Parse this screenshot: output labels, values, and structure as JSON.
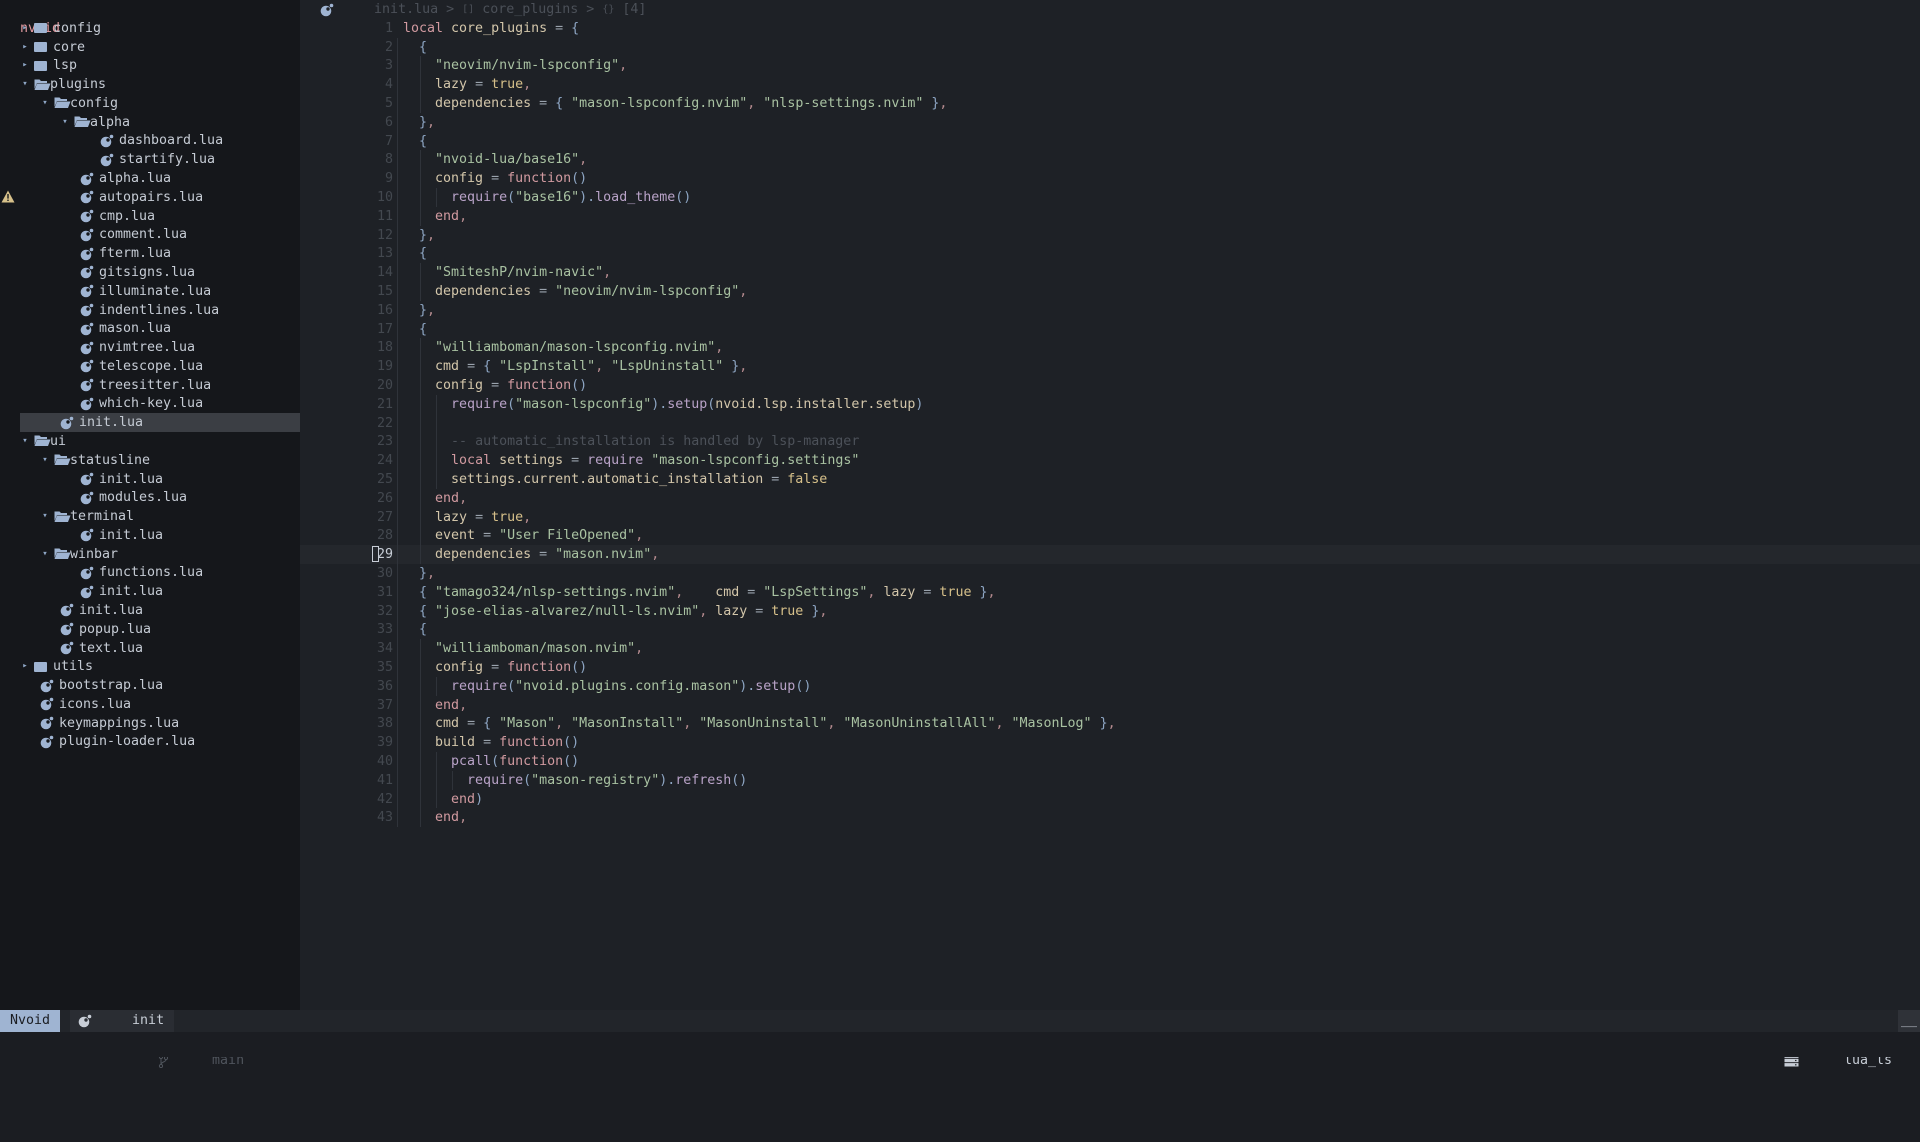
{
  "explorer": {
    "root": "nvoid",
    "items": [
      {
        "label": "config",
        "type": "folder",
        "open": false,
        "depth": 0
      },
      {
        "label": "core",
        "type": "folder",
        "open": false,
        "depth": 0
      },
      {
        "label": "lsp",
        "type": "folder",
        "open": false,
        "depth": 0
      },
      {
        "label": "plugins",
        "type": "folder",
        "open": true,
        "depth": 0
      },
      {
        "label": "config",
        "type": "folder",
        "open": true,
        "depth": 1
      },
      {
        "label": "alpha",
        "type": "folder",
        "open": true,
        "depth": 2
      },
      {
        "label": "dashboard.lua",
        "type": "file",
        "depth": 3
      },
      {
        "label": "startify.lua",
        "type": "file",
        "depth": 3
      },
      {
        "label": "alpha.lua",
        "type": "file",
        "depth": 2
      },
      {
        "label": "autopairs.lua",
        "type": "file",
        "depth": 2,
        "diagnostic": "warning"
      },
      {
        "label": "cmp.lua",
        "type": "file",
        "depth": 2
      },
      {
        "label": "comment.lua",
        "type": "file",
        "depth": 2
      },
      {
        "label": "fterm.lua",
        "type": "file",
        "depth": 2
      },
      {
        "label": "gitsigns.lua",
        "type": "file",
        "depth": 2
      },
      {
        "label": "illuminate.lua",
        "type": "file",
        "depth": 2
      },
      {
        "label": "indentlines.lua",
        "type": "file",
        "depth": 2
      },
      {
        "label": "mason.lua",
        "type": "file",
        "depth": 2
      },
      {
        "label": "nvimtree.lua",
        "type": "file",
        "depth": 2
      },
      {
        "label": "telescope.lua",
        "type": "file",
        "depth": 2
      },
      {
        "label": "treesitter.lua",
        "type": "file",
        "depth": 2
      },
      {
        "label": "which-key.lua",
        "type": "file",
        "depth": 2
      },
      {
        "label": "init.lua",
        "type": "file",
        "depth": 1,
        "selected": true
      },
      {
        "label": "ui",
        "type": "folder",
        "open": true,
        "depth": 0
      },
      {
        "label": "statusline",
        "type": "folder",
        "open": true,
        "depth": 1
      },
      {
        "label": "init.lua",
        "type": "file",
        "depth": 2
      },
      {
        "label": "modules.lua",
        "type": "file",
        "depth": 2
      },
      {
        "label": "terminal",
        "type": "folder",
        "open": true,
        "depth": 1
      },
      {
        "label": "init.lua",
        "type": "file",
        "depth": 2
      },
      {
        "label": "winbar",
        "type": "folder",
        "open": true,
        "depth": 1
      },
      {
        "label": "functions.lua",
        "type": "file",
        "depth": 2
      },
      {
        "label": "init.lua",
        "type": "file",
        "depth": 2
      },
      {
        "label": "init.lua",
        "type": "file",
        "depth": 1
      },
      {
        "label": "popup.lua",
        "type": "file",
        "depth": 1
      },
      {
        "label": "text.lua",
        "type": "file",
        "depth": 1
      },
      {
        "label": "utils",
        "type": "folder",
        "open": false,
        "depth": 0
      },
      {
        "label": "bootstrap.lua",
        "type": "file",
        "depth": 0
      },
      {
        "label": "icons.lua",
        "type": "file",
        "depth": 0
      },
      {
        "label": "keymappings.lua",
        "type": "file",
        "depth": 0
      },
      {
        "label": "plugin-loader.lua",
        "type": "file",
        "depth": 0
      }
    ]
  },
  "winbar": {
    "file": "init.lua",
    "sep": ">",
    "crumb1_icon": "[]",
    "crumb1": "core_plugins",
    "crumb2_icon": "{}",
    "crumb2": "[4]"
  },
  "editor": {
    "cursor_line": 29,
    "lines": [
      [
        [
          "kw",
          "local"
        ],
        [
          "id",
          " core_plugins "
        ],
        [
          "op",
          "="
        ],
        [
          "punc",
          " {"
        ]
      ],
      [
        [
          "punc",
          "  {"
        ]
      ],
      [
        [
          "plain",
          "    "
        ],
        [
          "str",
          "\"neovim/nvim-lspconfig\""
        ],
        [
          "comma",
          ","
        ]
      ],
      [
        [
          "plain",
          "    "
        ],
        [
          "id",
          "lazy "
        ],
        [
          "op",
          "="
        ],
        [
          "bool",
          " true"
        ],
        [
          "comma",
          ","
        ]
      ],
      [
        [
          "plain",
          "    "
        ],
        [
          "id",
          "dependencies "
        ],
        [
          "op",
          "="
        ],
        [
          "punc",
          " { "
        ],
        [
          "str",
          "\"mason-lspconfig.nvim\""
        ],
        [
          "comma",
          ", "
        ],
        [
          "str",
          "\"nlsp-settings.nvim\""
        ],
        [
          "punc",
          " }"
        ],
        [
          "comma",
          ","
        ]
      ],
      [
        [
          "punc",
          "  }"
        ],
        [
          "comma",
          ","
        ]
      ],
      [
        [
          "punc",
          "  {"
        ]
      ],
      [
        [
          "plain",
          "    "
        ],
        [
          "str",
          "\"nvoid-lua/base16\""
        ],
        [
          "comma",
          ","
        ]
      ],
      [
        [
          "plain",
          "    "
        ],
        [
          "id",
          "config "
        ],
        [
          "op",
          "="
        ],
        [
          "kw",
          " function"
        ],
        [
          "punc",
          "()"
        ]
      ],
      [
        [
          "plain",
          "      "
        ],
        [
          "fn",
          "require"
        ],
        [
          "punc",
          "("
        ],
        [
          "str",
          "\"base16\""
        ],
        [
          "punc",
          ")."
        ],
        [
          "fn",
          "load_theme"
        ],
        [
          "punc",
          "()"
        ]
      ],
      [
        [
          "plain",
          "    "
        ],
        [
          "kw",
          "end"
        ],
        [
          "comma",
          ","
        ]
      ],
      [
        [
          "punc",
          "  }"
        ],
        [
          "comma",
          ","
        ]
      ],
      [
        [
          "punc",
          "  {"
        ]
      ],
      [
        [
          "plain",
          "    "
        ],
        [
          "str",
          "\"SmiteshP/nvim-navic\""
        ],
        [
          "comma",
          ","
        ]
      ],
      [
        [
          "plain",
          "    "
        ],
        [
          "id",
          "dependencies "
        ],
        [
          "op",
          "="
        ],
        [
          "str",
          " \"neovim/nvim-lspconfig\""
        ],
        [
          "comma",
          ","
        ]
      ],
      [
        [
          "punc",
          "  }"
        ],
        [
          "comma",
          ","
        ]
      ],
      [
        [
          "punc",
          "  {"
        ]
      ],
      [
        [
          "plain",
          "    "
        ],
        [
          "str",
          "\"williamboman/mason-lspconfig.nvim\""
        ],
        [
          "comma",
          ","
        ]
      ],
      [
        [
          "plain",
          "    "
        ],
        [
          "id",
          "cmd "
        ],
        [
          "op",
          "="
        ],
        [
          "punc",
          " { "
        ],
        [
          "str",
          "\"LspInstall\""
        ],
        [
          "comma",
          ", "
        ],
        [
          "str",
          "\"LspUninstall\""
        ],
        [
          "punc",
          " }"
        ],
        [
          "comma",
          ","
        ]
      ],
      [
        [
          "plain",
          "    "
        ],
        [
          "id",
          "config "
        ],
        [
          "op",
          "="
        ],
        [
          "kw",
          " function"
        ],
        [
          "punc",
          "()"
        ]
      ],
      [
        [
          "plain",
          "      "
        ],
        [
          "fn",
          "require"
        ],
        [
          "punc",
          "("
        ],
        [
          "str",
          "\"mason-lspconfig\""
        ],
        [
          "punc",
          ")."
        ],
        [
          "fn",
          "setup"
        ],
        [
          "punc",
          "("
        ],
        [
          "id",
          "nvoid.lsp.installer.setup"
        ],
        [
          "punc",
          ")"
        ]
      ],
      [],
      [
        [
          "plain",
          "      "
        ],
        [
          "cmt",
          "-- automatic_installation is handled by lsp-manager"
        ]
      ],
      [
        [
          "plain",
          "      "
        ],
        [
          "kw",
          "local"
        ],
        [
          "id",
          " settings "
        ],
        [
          "op",
          "="
        ],
        [
          "fn",
          " require"
        ],
        [
          "str",
          " \"mason-lspconfig.settings\""
        ]
      ],
      [
        [
          "plain",
          "      "
        ],
        [
          "id",
          "settings.current.automatic_installation "
        ],
        [
          "op",
          "="
        ],
        [
          "bool",
          " false"
        ]
      ],
      [
        [
          "plain",
          "    "
        ],
        [
          "kw",
          "end"
        ],
        [
          "comma",
          ","
        ]
      ],
      [
        [
          "plain",
          "    "
        ],
        [
          "id",
          "lazy "
        ],
        [
          "op",
          "="
        ],
        [
          "bool",
          " true"
        ],
        [
          "comma",
          ","
        ]
      ],
      [
        [
          "plain",
          "    "
        ],
        [
          "id",
          "event "
        ],
        [
          "op",
          "="
        ],
        [
          "str",
          " \"User FileOpened\""
        ],
        [
          "comma",
          ","
        ]
      ],
      [
        [
          "plain",
          "    "
        ],
        [
          "id",
          "dependencies "
        ],
        [
          "op",
          "="
        ],
        [
          "str",
          " \"mason.nvim\""
        ],
        [
          "comma",
          ","
        ]
      ],
      [
        [
          "punc",
          "  }"
        ],
        [
          "comma",
          ","
        ]
      ],
      [
        [
          "punc",
          "  { "
        ],
        [
          "str",
          "\"tamago324/nlsp-settings.nvim\""
        ],
        [
          "comma",
          ",    "
        ],
        [
          "id",
          "cmd "
        ],
        [
          "op",
          "="
        ],
        [
          "str",
          " \"LspSettings\""
        ],
        [
          "comma",
          ", "
        ],
        [
          "id",
          "lazy "
        ],
        [
          "op",
          "="
        ],
        [
          "bool",
          " true"
        ],
        [
          "punc",
          " }"
        ],
        [
          "comma",
          ","
        ]
      ],
      [
        [
          "punc",
          "  { "
        ],
        [
          "str",
          "\"jose-elias-alvarez/null-ls.nvim\""
        ],
        [
          "comma",
          ", "
        ],
        [
          "id",
          "lazy "
        ],
        [
          "op",
          "="
        ],
        [
          "bool",
          " true"
        ],
        [
          "punc",
          " }"
        ],
        [
          "comma",
          ","
        ]
      ],
      [
        [
          "punc",
          "  {"
        ]
      ],
      [
        [
          "plain",
          "    "
        ],
        [
          "str",
          "\"williamboman/mason.nvim\""
        ],
        [
          "comma",
          ","
        ]
      ],
      [
        [
          "plain",
          "    "
        ],
        [
          "id",
          "config "
        ],
        [
          "op",
          "="
        ],
        [
          "kw",
          " function"
        ],
        [
          "punc",
          "()"
        ]
      ],
      [
        [
          "plain",
          "      "
        ],
        [
          "fn",
          "require"
        ],
        [
          "punc",
          "("
        ],
        [
          "str",
          "\"nvoid.plugins.config.mason\""
        ],
        [
          "punc",
          ")."
        ],
        [
          "fn",
          "setup"
        ],
        [
          "punc",
          "()"
        ]
      ],
      [
        [
          "plain",
          "    "
        ],
        [
          "kw",
          "end"
        ],
        [
          "comma",
          ","
        ]
      ],
      [
        [
          "plain",
          "    "
        ],
        [
          "id",
          "cmd "
        ],
        [
          "op",
          "="
        ],
        [
          "punc",
          " { "
        ],
        [
          "str",
          "\"Mason\""
        ],
        [
          "comma",
          ", "
        ],
        [
          "str",
          "\"MasonInstall\""
        ],
        [
          "comma",
          ", "
        ],
        [
          "str",
          "\"MasonUninstall\""
        ],
        [
          "comma",
          ", "
        ],
        [
          "str",
          "\"MasonUninstallAll\""
        ],
        [
          "comma",
          ", "
        ],
        [
          "str",
          "\"MasonLog\""
        ],
        [
          "punc",
          " }"
        ],
        [
          "comma",
          ","
        ]
      ],
      [
        [
          "plain",
          "    "
        ],
        [
          "id",
          "build "
        ],
        [
          "op",
          "="
        ],
        [
          "kw",
          " function"
        ],
        [
          "punc",
          "()"
        ]
      ],
      [
        [
          "plain",
          "      "
        ],
        [
          "fn",
          "pcall"
        ],
        [
          "punc",
          "("
        ],
        [
          "kw",
          "function"
        ],
        [
          "punc",
          "()"
        ]
      ],
      [
        [
          "plain",
          "        "
        ],
        [
          "fn",
          "require"
        ],
        [
          "punc",
          "("
        ],
        [
          "str",
          "\"mason-registry\""
        ],
        [
          "punc",
          ")."
        ],
        [
          "fn",
          "refresh"
        ],
        [
          "punc",
          "()"
        ]
      ],
      [
        [
          "plain",
          "      "
        ],
        [
          "kw",
          "end"
        ],
        [
          "punc",
          ")"
        ]
      ],
      [
        [
          "plain",
          "    "
        ],
        [
          "kw",
          "end"
        ],
        [
          "comma",
          ","
        ]
      ]
    ]
  },
  "statusline": {
    "mode": "Nvoid",
    "file": "init",
    "branch": "main",
    "lsp": "lua_ls",
    "right_end": "__"
  },
  "colors": {
    "accent": "#9fb4d2",
    "warning": "#d6c08a",
    "root_label": "#e29aa0"
  }
}
